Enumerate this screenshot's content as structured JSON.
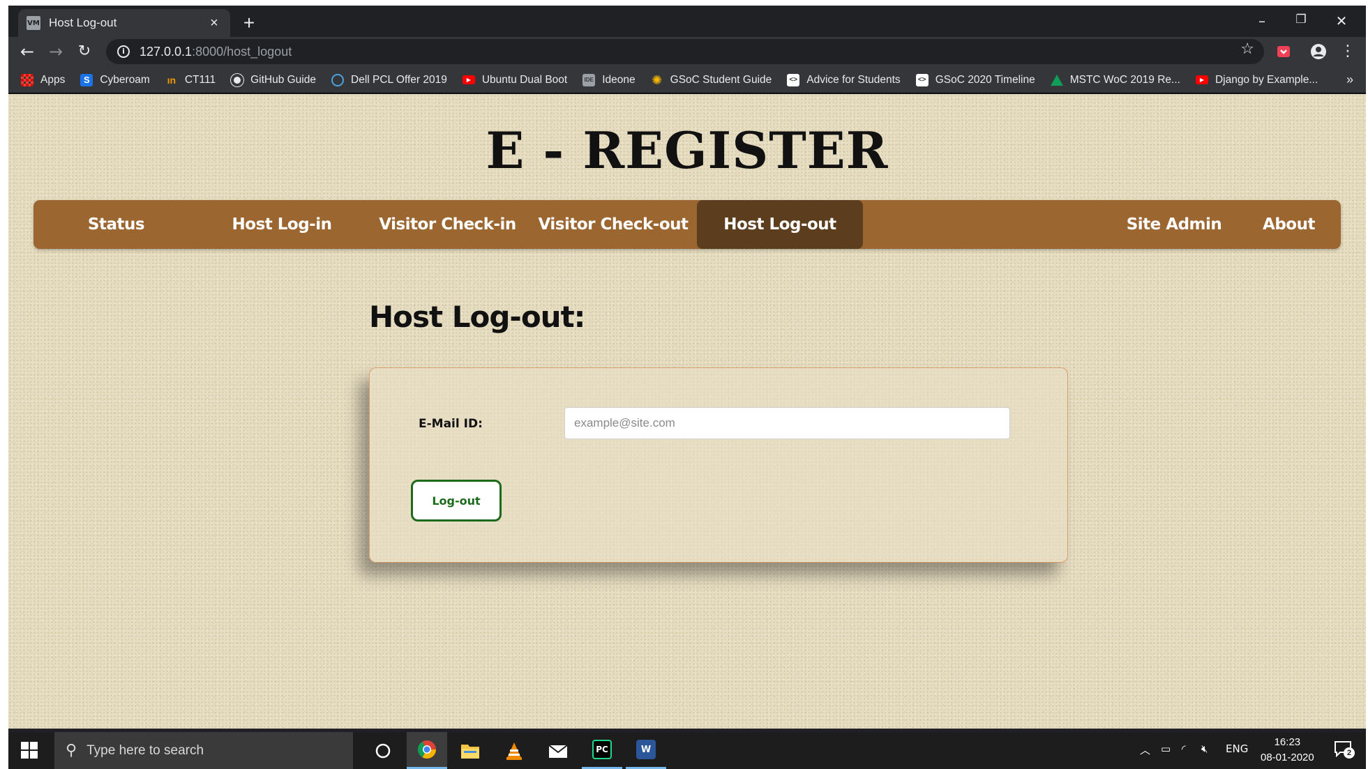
{
  "browser": {
    "tab_title": "Host Log-out",
    "favicon_text": "VM",
    "close_glyph": "×",
    "new_tab_glyph": "+",
    "url_host": "127.0.0.1",
    "url_path": ":8000/host_logout",
    "window_controls": [
      "–",
      "❐",
      "✕"
    ]
  },
  "bookmarks": {
    "items": [
      {
        "label": "Apps",
        "icon": "apps-grid-icon",
        "color": "#e94235"
      },
      {
        "label": "Cyberoam",
        "icon": "cyberoam-icon",
        "color": "#1a73e8"
      },
      {
        "label": "CT111",
        "icon": "ct111-icon",
        "color": "#f29900"
      },
      {
        "label": "GitHub Guide",
        "icon": "github-icon",
        "color": "#ffffff"
      },
      {
        "label": "Dell PCL Offer 2019",
        "icon": "dell-icon",
        "color": "#4aa3df"
      },
      {
        "label": "Ubuntu Dual Boot",
        "icon": "youtube-icon",
        "color": "#ff0000"
      },
      {
        "label": "Ideone",
        "icon": "ideone-icon",
        "color": "#9aa0a6"
      },
      {
        "label": "GSoC Student Guide",
        "icon": "gsoc-icon",
        "color": "#f4b400"
      },
      {
        "label": "Advice for Students",
        "icon": "gsoc-code-icon",
        "color": "#ffffff"
      },
      {
        "label": "GSoC 2020 Timeline",
        "icon": "gsoc-code-icon",
        "color": "#ffffff"
      },
      {
        "label": "MSTC WoC 2019 Re...",
        "icon": "google-drive-icon",
        "color": "#0f9d58"
      },
      {
        "label": "Django by Example...",
        "icon": "youtube-icon",
        "color": "#ff0000"
      }
    ],
    "more": "»"
  },
  "page": {
    "site_title": "E - REGISTER",
    "nav": {
      "status": "Status",
      "host_login": "Host Log-in",
      "visitor_checkin": "Visitor Check-in",
      "visitor_checkout": "Visitor Check-out",
      "host_logout": "Host Log-out",
      "site_admin": "Site Admin",
      "about": "About",
      "active": "Host Log-out"
    },
    "heading": "Host Log-out:",
    "form": {
      "email_label": "E-Mail ID:",
      "email_placeholder": "example@site.com",
      "email_value": "",
      "submit_label": "Log-out"
    }
  },
  "taskbar": {
    "search_placeholder": "Type here to search",
    "apps": [
      "cortana-icon",
      "chrome-icon",
      "file-explorer-icon",
      "vlc-icon",
      "mail-icon",
      "pycharm-icon",
      "word-icon"
    ],
    "tray_language": "ENG",
    "time": "16:23",
    "date": "08-01-2020",
    "notification_count": "2"
  },
  "colors": {
    "nav_bg": "#9c6631",
    "nav_active_bg": "#5c3d1e",
    "button_green": "#1c6a1c",
    "card_border": "#d8a070"
  }
}
